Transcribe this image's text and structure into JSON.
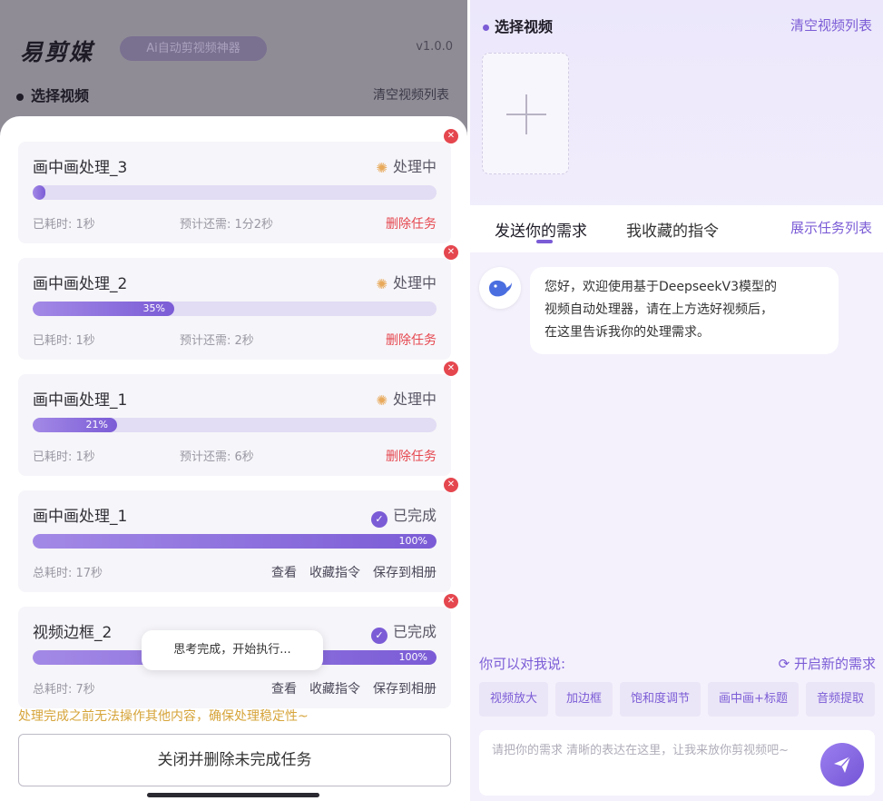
{
  "left": {
    "logo": "易剪媒",
    "slogan": "Ai自动剪视频神器",
    "version": "v1.0.0",
    "section_title": "选择视频",
    "clear_list": "清空视频列表",
    "tasks": [
      {
        "name": "画中画处理_3",
        "status": "处理中",
        "progress_label": "",
        "progress": 0.03,
        "elapsed": "已耗时: 1秒",
        "remaining": "预计还需: 1分2秒",
        "delete": "删除任务"
      },
      {
        "name": "画中画处理_2",
        "status": "处理中",
        "progress_label": "35%",
        "progress": 0.35,
        "elapsed": "已耗时: 1秒",
        "remaining": "预计还需: 2秒",
        "delete": "删除任务"
      },
      {
        "name": "画中画处理_1",
        "status": "处理中",
        "progress_label": "21%",
        "progress": 0.21,
        "elapsed": "已耗时: 1秒",
        "remaining": "预计还需: 6秒",
        "delete": "删除任务"
      },
      {
        "name": "画中画处理_1",
        "status": "已完成",
        "progress_label": "100%",
        "progress": 1.0,
        "elapsed": "总耗时: 17秒",
        "view": "查看",
        "collect": "收藏指令",
        "save": "保存到相册"
      },
      {
        "name": "视频边框_2",
        "status": "已完成",
        "progress_label": "100%",
        "progress": 1.0,
        "elapsed": "总耗时: 7秒",
        "view": "查看",
        "collect": "收藏指令",
        "save": "保存到相册"
      }
    ],
    "toast": "思考完成，开始执行...",
    "warning": "处理完成之前无法操作其他内容，确保处理稳定性~",
    "close_button": "关闭并删除未完成任务"
  },
  "right": {
    "section_title": "选择视频",
    "clear_list": "清空视频列表",
    "tabs": [
      "发送你的需求",
      "我收藏的指令"
    ],
    "show_tasks": "展示任务列表",
    "bot_message_lines": [
      "您好，欢迎使用基于DeepseekV3模型的",
      "视频自动处理器，请在上方选好视频后，",
      "在这里告诉我你的处理需求。"
    ],
    "say_label": "你可以对我说:",
    "new_request": "开启新的需求",
    "new_request_icon": "refresh-icon",
    "chips": [
      "视频放大",
      "加边框",
      "饱和度调节",
      "画中画+标题",
      "音频提取"
    ],
    "input_placeholder": "请把你的需求 清晰的表达在这里，让我来放你剪视频吧~"
  },
  "colors": {
    "accent": "#7b5cd6",
    "danger": "#e5474f",
    "warning": "#d6a43a",
    "processing": "#e8a95a"
  }
}
